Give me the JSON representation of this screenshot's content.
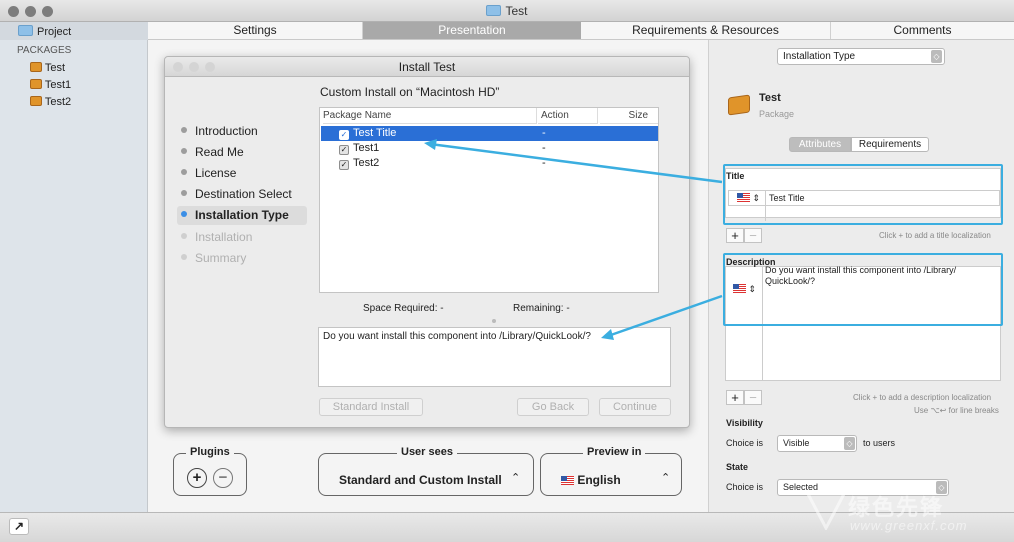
{
  "window": {
    "title": "Test"
  },
  "tabs": [
    "Settings",
    "Presentation",
    "Requirements & Resources",
    "Comments"
  ],
  "sidebar": {
    "project_label": "Project",
    "section_label": "PACKAGES",
    "packages": [
      "Test",
      "Test1",
      "Test2"
    ]
  },
  "sheet": {
    "title": "Install Test",
    "heading": "Custom Install on “Macintosh HD”",
    "steps": [
      "Introduction",
      "Read Me",
      "License",
      "Destination Select",
      "Installation Type",
      "Installation",
      "Summary"
    ],
    "columns": {
      "name": "Package Name",
      "action": "Action",
      "size": "Size"
    },
    "rows": [
      {
        "name": "Test Title",
        "action": "-"
      },
      {
        "name": "Test1",
        "action": "-"
      },
      {
        "name": "Test2",
        "action": "-"
      }
    ],
    "space_required": "Space Required:  -",
    "remaining": "Remaining:  -",
    "description": "Do you want install this component into /Library/QuickLook/?",
    "buttons": {
      "standard": "Standard Install",
      "back": "Go Back",
      "continue": "Continue"
    }
  },
  "bottom_controls": {
    "plugins_label": "Plugins",
    "user_sees_label": "User sees",
    "user_sees_value": "Standard and Custom Install",
    "preview_label": "Preview in",
    "preview_value": "English"
  },
  "inspector": {
    "popup": "Installation Type",
    "pkg_name": "Test",
    "pkg_kind": "Package",
    "seg": [
      "Attributes",
      "Requirements"
    ],
    "title_label": "Title",
    "title_value": "Test Title",
    "title_hint": "Click + to add a title localization",
    "desc_label": "Description",
    "desc_value": "Do you want install this component into /Library/ QuickLook/?",
    "desc_hint1": "Click + to add a description localization",
    "desc_hint2": "Use ⌥↩ for line breaks",
    "visibility_label": "Visibility",
    "choice_is": "Choice is",
    "visibility_value": "Visible",
    "to_users": "to users",
    "state_label": "State",
    "state_value": "Selected"
  },
  "watermark": {
    "logo": "绿色先锋",
    "url": "www.greenxf.com"
  },
  "colors": {
    "accent": "#3baee0",
    "selection": "#2a6fd6"
  }
}
